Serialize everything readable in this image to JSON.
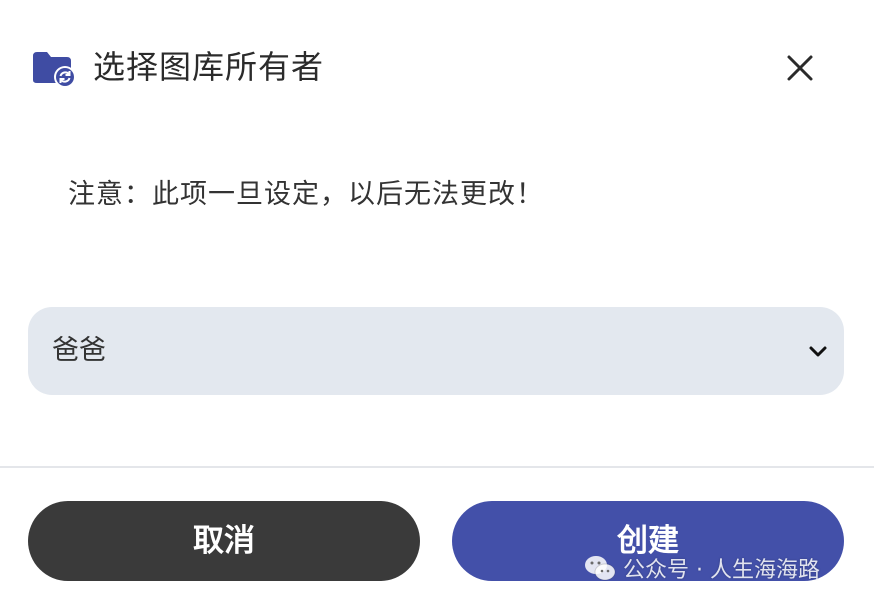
{
  "dialog": {
    "title": "选择图库所有者",
    "icon": "folder-sync-icon",
    "close_icon": "close-icon",
    "notice": "注意：此项一旦设定，以后无法更改！",
    "owner_select": {
      "selected": "爸爸",
      "icon": "chevron-down-icon"
    },
    "buttons": {
      "cancel": "取消",
      "create": "创建"
    },
    "colors": {
      "accent": "#4350a9",
      "cancel_bg": "#3a3a3a",
      "select_bg": "#e3e8ef"
    }
  },
  "watermark": {
    "text": "公众号 · 人生海海路",
    "icon": "wechat-icon"
  }
}
